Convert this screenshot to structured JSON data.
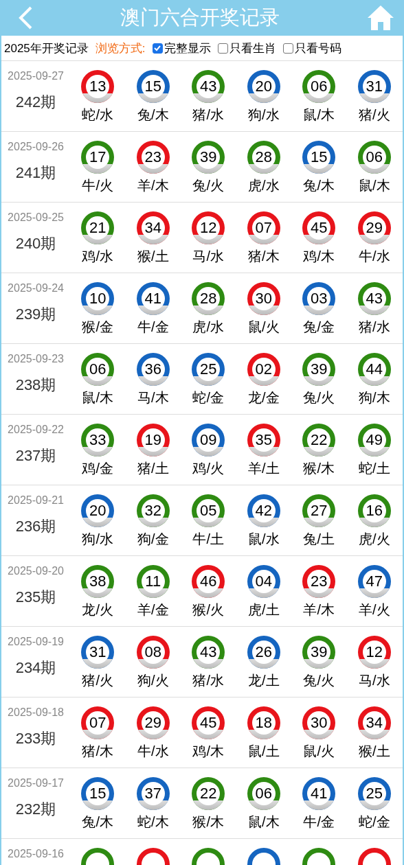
{
  "header": {
    "title": "澳门六合开奖记录"
  },
  "filter": {
    "year_label": "2025年开奖记录",
    "mode_label": "浏览方式:",
    "options": [
      {
        "label": "完整显示",
        "checked": true
      },
      {
        "label": "只看生肖",
        "checked": false
      },
      {
        "label": "只看号码",
        "checked": false
      }
    ]
  },
  "draws": [
    {
      "date": "2025-09-27",
      "period": "242期",
      "balls": [
        {
          "number": "13",
          "color": "#e8141b",
          "sign": "蛇/水"
        },
        {
          "number": "15",
          "color": "#1565c0",
          "sign": "兔/木"
        },
        {
          "number": "43",
          "color": "#2e8b12",
          "sign": "猪/水"
        },
        {
          "number": "20",
          "color": "#1565c0",
          "sign": "狗/水"
        },
        {
          "number": "06",
          "color": "#2e8b12",
          "sign": "鼠/木"
        },
        {
          "number": "31",
          "color": "#1565c0",
          "sign": "猪/火"
        }
      ]
    },
    {
      "date": "2025-09-26",
      "period": "241期",
      "balls": [
        {
          "number": "17",
          "color": "#2e8b12",
          "sign": "牛/火"
        },
        {
          "number": "23",
          "color": "#e8141b",
          "sign": "羊/木"
        },
        {
          "number": "39",
          "color": "#2e8b12",
          "sign": "兔/火"
        },
        {
          "number": "28",
          "color": "#2e8b12",
          "sign": "虎/水"
        },
        {
          "number": "15",
          "color": "#1565c0",
          "sign": "兔/木"
        },
        {
          "number": "06",
          "color": "#2e8b12",
          "sign": "鼠/木"
        }
      ]
    },
    {
      "date": "2025-09-25",
      "period": "240期",
      "balls": [
        {
          "number": "21",
          "color": "#2e8b12",
          "sign": "鸡/水"
        },
        {
          "number": "34",
          "color": "#e8141b",
          "sign": "猴/土"
        },
        {
          "number": "12",
          "color": "#e8141b",
          "sign": "马/水"
        },
        {
          "number": "07",
          "color": "#e8141b",
          "sign": "猪/木"
        },
        {
          "number": "45",
          "color": "#e8141b",
          "sign": "鸡/木"
        },
        {
          "number": "29",
          "color": "#e8141b",
          "sign": "牛/水"
        }
      ]
    },
    {
      "date": "2025-09-24",
      "period": "239期",
      "balls": [
        {
          "number": "10",
          "color": "#1565c0",
          "sign": "猴/金"
        },
        {
          "number": "41",
          "color": "#1565c0",
          "sign": "牛/金"
        },
        {
          "number": "28",
          "color": "#2e8b12",
          "sign": "虎/水"
        },
        {
          "number": "30",
          "color": "#e8141b",
          "sign": "鼠/火"
        },
        {
          "number": "03",
          "color": "#1565c0",
          "sign": "兔/金"
        },
        {
          "number": "43",
          "color": "#2e8b12",
          "sign": "猪/水"
        }
      ]
    },
    {
      "date": "2025-09-23",
      "period": "238期",
      "balls": [
        {
          "number": "06",
          "color": "#2e8b12",
          "sign": "鼠/木"
        },
        {
          "number": "36",
          "color": "#1565c0",
          "sign": "马/木"
        },
        {
          "number": "25",
          "color": "#1565c0",
          "sign": "蛇/金"
        },
        {
          "number": "02",
          "color": "#e8141b",
          "sign": "龙/金"
        },
        {
          "number": "39",
          "color": "#2e8b12",
          "sign": "兔/火"
        },
        {
          "number": "44",
          "color": "#2e8b12",
          "sign": "狗/木"
        }
      ]
    },
    {
      "date": "2025-09-22",
      "period": "237期",
      "balls": [
        {
          "number": "33",
          "color": "#2e8b12",
          "sign": "鸡/金"
        },
        {
          "number": "19",
          "color": "#e8141b",
          "sign": "猪/土"
        },
        {
          "number": "09",
          "color": "#1565c0",
          "sign": "鸡/火"
        },
        {
          "number": "35",
          "color": "#e8141b",
          "sign": "羊/土"
        },
        {
          "number": "22",
          "color": "#2e8b12",
          "sign": "猴/木"
        },
        {
          "number": "49",
          "color": "#2e8b12",
          "sign": "蛇/土"
        }
      ]
    },
    {
      "date": "2025-09-21",
      "period": "236期",
      "balls": [
        {
          "number": "20",
          "color": "#1565c0",
          "sign": "狗/水"
        },
        {
          "number": "32",
          "color": "#2e8b12",
          "sign": "狗/金"
        },
        {
          "number": "05",
          "color": "#2e8b12",
          "sign": "牛/土"
        },
        {
          "number": "42",
          "color": "#1565c0",
          "sign": "鼠/水"
        },
        {
          "number": "27",
          "color": "#2e8b12",
          "sign": "兔/土"
        },
        {
          "number": "16",
          "color": "#2e8b12",
          "sign": "虎/火"
        }
      ]
    },
    {
      "date": "2025-09-20",
      "period": "235期",
      "balls": [
        {
          "number": "38",
          "color": "#2e8b12",
          "sign": "龙/火"
        },
        {
          "number": "11",
          "color": "#2e8b12",
          "sign": "羊/金"
        },
        {
          "number": "46",
          "color": "#e8141b",
          "sign": "猴/火"
        },
        {
          "number": "04",
          "color": "#1565c0",
          "sign": "虎/土"
        },
        {
          "number": "23",
          "color": "#e8141b",
          "sign": "羊/木"
        },
        {
          "number": "47",
          "color": "#1565c0",
          "sign": "羊/火"
        }
      ]
    },
    {
      "date": "2025-09-19",
      "period": "234期",
      "balls": [
        {
          "number": "31",
          "color": "#1565c0",
          "sign": "猪/火"
        },
        {
          "number": "08",
          "color": "#e8141b",
          "sign": "狗/火"
        },
        {
          "number": "43",
          "color": "#2e8b12",
          "sign": "猪/水"
        },
        {
          "number": "26",
          "color": "#1565c0",
          "sign": "龙/土"
        },
        {
          "number": "39",
          "color": "#2e8b12",
          "sign": "兔/火"
        },
        {
          "number": "12",
          "color": "#e8141b",
          "sign": "马/水"
        }
      ]
    },
    {
      "date": "2025-09-18",
      "period": "233期",
      "balls": [
        {
          "number": "07",
          "color": "#e8141b",
          "sign": "猪/木"
        },
        {
          "number": "29",
          "color": "#e8141b",
          "sign": "牛/水"
        },
        {
          "number": "45",
          "color": "#e8141b",
          "sign": "鸡/木"
        },
        {
          "number": "18",
          "color": "#e8141b",
          "sign": "鼠/土"
        },
        {
          "number": "30",
          "color": "#e8141b",
          "sign": "鼠/火"
        },
        {
          "number": "34",
          "color": "#e8141b",
          "sign": "猴/土"
        }
      ]
    },
    {
      "date": "2025-09-17",
      "period": "232期",
      "balls": [
        {
          "number": "15",
          "color": "#1565c0",
          "sign": "兔/木"
        },
        {
          "number": "37",
          "color": "#1565c0",
          "sign": "蛇/木"
        },
        {
          "number": "22",
          "color": "#2e8b12",
          "sign": "猴/木"
        },
        {
          "number": "06",
          "color": "#2e8b12",
          "sign": "鼠/木"
        },
        {
          "number": "41",
          "color": "#1565c0",
          "sign": "牛/金"
        },
        {
          "number": "25",
          "color": "#1565c0",
          "sign": "蛇/金"
        }
      ]
    },
    {
      "date": "2025-09-16",
      "balls": [
        {
          "color": "#2e8b12"
        },
        {
          "color": "#e8141b"
        },
        {
          "color": "#2e8b12"
        },
        {
          "color": "#1565c0"
        },
        {
          "color": "#2e8b12"
        },
        {
          "color": "#e8141b"
        }
      ]
    }
  ]
}
